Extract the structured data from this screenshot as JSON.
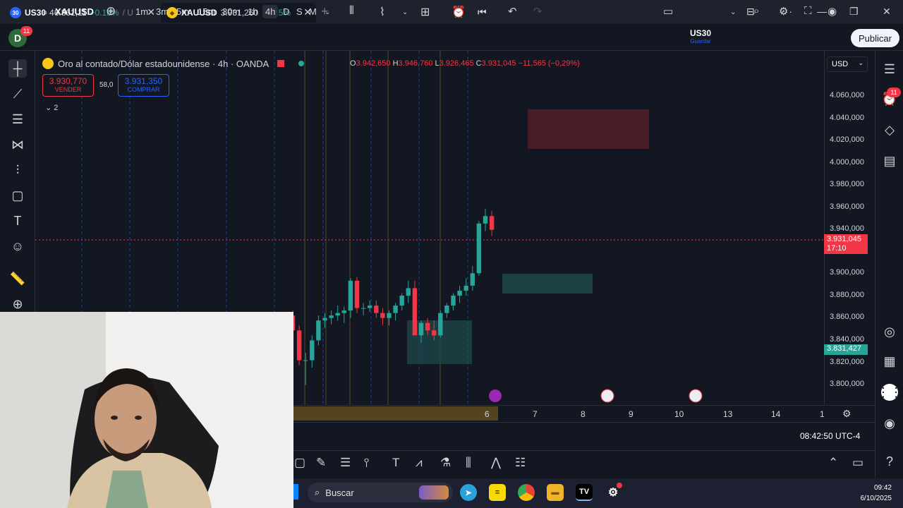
{
  "tabs": [
    {
      "badge": "30",
      "symbol": "US30",
      "price": "46.861,11",
      "change": "+0.18%",
      "extra": "/ U"
    },
    {
      "badge": "◆",
      "symbol": "XAUUSD",
      "price": "3.931,260",
      "change": "+1.15%"
    }
  ],
  "toolbar": {
    "avatar": "D",
    "avatar_badge": "11",
    "symbol": "XAUUSD",
    "timeframes": [
      "1m",
      "3m",
      "5m",
      "15m",
      "30m",
      "1h",
      "4h",
      "D",
      "S",
      "M"
    ],
    "active_timeframe": "4h",
    "compare_symbol": "US30",
    "compare_sub": "Guardar",
    "publish": "Publicar"
  },
  "legend": {
    "title": "Oro al contado/Dólar estadounidense · 4h · OANDA",
    "open_label": "O",
    "open": "3.942,650",
    "high_label": "H",
    "high": "3.946,760",
    "low_label": "L",
    "low": "3.926,465",
    "close_label": "C",
    "close": "3.931,045",
    "change": "−11,565 (−0,29%)",
    "sell_price": "3.930,770",
    "sell_label": "VENDER",
    "spread": "58,0",
    "buy_price": "3.931,350",
    "buy_label": "COMPRAR",
    "indicators_count": "2"
  },
  "price_axis": {
    "currency": "USD",
    "labels": [
      "4.060,000",
      "4.040,000",
      "4.020,000",
      "4.000,000",
      "3.980,000",
      "3.960,000",
      "3.940,000",
      "3.900,000",
      "3.880,000",
      "3.860,000",
      "3.840,000",
      "3.820,000",
      "3.800,000"
    ],
    "current_price": "3.931,045",
    "countdown": "17:10",
    "marker_price": "3.831,427"
  },
  "time_axis": {
    "labels": [
      "6",
      "7",
      "8",
      "9",
      "10",
      "13",
      "14",
      "1"
    ],
    "clock": "08:42:50 UTC-4"
  },
  "taskbar": {
    "search": "Buscar",
    "time": "09:42",
    "date": "6/10/2025"
  },
  "colors": {
    "bg": "#131722",
    "up": "#26a69a",
    "down": "#f23645",
    "accent": "#2962ff"
  },
  "chart_data": {
    "type": "candlestick",
    "ylim": [
      3790,
      4075
    ],
    "candles": [
      {
        "o": 3862,
        "h": 3866,
        "l": 3840,
        "c": 3850
      },
      {
        "o": 3850,
        "h": 3854,
        "l": 3822,
        "c": 3826
      },
      {
        "o": 3826,
        "h": 3832,
        "l": 3806,
        "c": 3826
      },
      {
        "o": 3826,
        "h": 3846,
        "l": 3820,
        "c": 3842
      },
      {
        "o": 3842,
        "h": 3862,
        "l": 3838,
        "c": 3858
      },
      {
        "o": 3858,
        "h": 3864,
        "l": 3852,
        "c": 3860
      },
      {
        "o": 3860,
        "h": 3866,
        "l": 3855,
        "c": 3862
      },
      {
        "o": 3862,
        "h": 3870,
        "l": 3858,
        "c": 3864
      },
      {
        "o": 3864,
        "h": 3869,
        "l": 3856,
        "c": 3866
      },
      {
        "o": 3866,
        "h": 3892,
        "l": 3860,
        "c": 3890
      },
      {
        "o": 3890,
        "h": 3893,
        "l": 3864,
        "c": 3868
      },
      {
        "o": 3868,
        "h": 3872,
        "l": 3862,
        "c": 3868
      },
      {
        "o": 3868,
        "h": 3874,
        "l": 3865,
        "c": 3870
      },
      {
        "o": 3870,
        "h": 3874,
        "l": 3860,
        "c": 3864
      },
      {
        "o": 3864,
        "h": 3868,
        "l": 3854,
        "c": 3860
      },
      {
        "o": 3860,
        "h": 3866,
        "l": 3854,
        "c": 3864
      },
      {
        "o": 3864,
        "h": 3872,
        "l": 3858,
        "c": 3870
      },
      {
        "o": 3870,
        "h": 3880,
        "l": 3866,
        "c": 3878
      },
      {
        "o": 3878,
        "h": 3890,
        "l": 3872,
        "c": 3884
      },
      {
        "o": 3884,
        "h": 3890,
        "l": 3850,
        "c": 3846
      },
      {
        "o": 3846,
        "h": 3858,
        "l": 3840,
        "c": 3856
      },
      {
        "o": 3856,
        "h": 3860,
        "l": 3846,
        "c": 3850
      },
      {
        "o": 3850,
        "h": 3858,
        "l": 3842,
        "c": 3846
      },
      {
        "o": 3846,
        "h": 3866,
        "l": 3844,
        "c": 3864
      },
      {
        "o": 3864,
        "h": 3872,
        "l": 3860,
        "c": 3870
      },
      {
        "o": 3870,
        "h": 3880,
        "l": 3866,
        "c": 3878
      },
      {
        "o": 3878,
        "h": 3886,
        "l": 3872,
        "c": 3882
      },
      {
        "o": 3882,
        "h": 3892,
        "l": 3878,
        "c": 3886
      },
      {
        "o": 3886,
        "h": 3902,
        "l": 3882,
        "c": 3896
      },
      {
        "o": 3896,
        "h": 3938,
        "l": 3894,
        "c": 3936
      },
      {
        "o": 3936,
        "h": 3948,
        "l": 3930,
        "c": 3942
      },
      {
        "o": 3942,
        "h": 3946,
        "l": 3926,
        "c": 3931
      }
    ]
  }
}
